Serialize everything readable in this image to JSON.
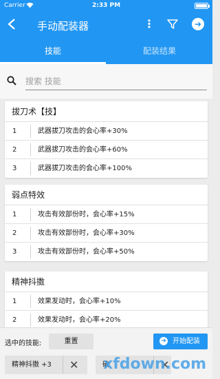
{
  "status_bar": {
    "carrier": "Carrier",
    "time": "2:33 PM"
  },
  "app_bar": {
    "title": "手动配装器",
    "back_icon": "back-arrow-icon",
    "more_icon": "more-vertical-icon",
    "filter_icon": "filter-icon",
    "go_icon": "arrow-right-circle-icon"
  },
  "tabs": [
    {
      "label": "技能",
      "active": true
    },
    {
      "label": "配装结果",
      "active": false
    }
  ],
  "search": {
    "placeholder": "搜索 技能",
    "value": ""
  },
  "skills": [
    {
      "name": "拔刀术【技】",
      "levels": [
        {
          "num": "1",
          "effect": "武器拔刀攻击的会心率+30%"
        },
        {
          "num": "2",
          "effect": "武器拔刀攻击的会心率+60%"
        },
        {
          "num": "3",
          "effect": "武器拔刀攻击的会心率+100%"
        }
      ]
    },
    {
      "name": "弱点特效",
      "levels": [
        {
          "num": "1",
          "effect": "攻击有效部份时，会心率+15%"
        },
        {
          "num": "2",
          "effect": "攻击有效部份时，会心率+30%"
        },
        {
          "num": "3",
          "effect": "攻击有效部份时，会心率+50%"
        }
      ]
    },
    {
      "name": "精神抖擞",
      "levels": [
        {
          "num": "1",
          "effect": "效果发动时，会心率+10%"
        },
        {
          "num": "2",
          "effect": "效果发动时，会心率+20%"
        }
      ]
    }
  ],
  "bottom_bar": {
    "selected_label": "选中的技能:",
    "reset_label": "重置",
    "start_label": "开始配装",
    "chips": [
      {
        "label": "精神抖擞 +3"
      },
      {
        "label": "破"
      }
    ]
  },
  "watermark": "xfdown.com",
  "colors": {
    "primary": "#2196f3",
    "background": "#ececec",
    "card": "#ffffff"
  }
}
